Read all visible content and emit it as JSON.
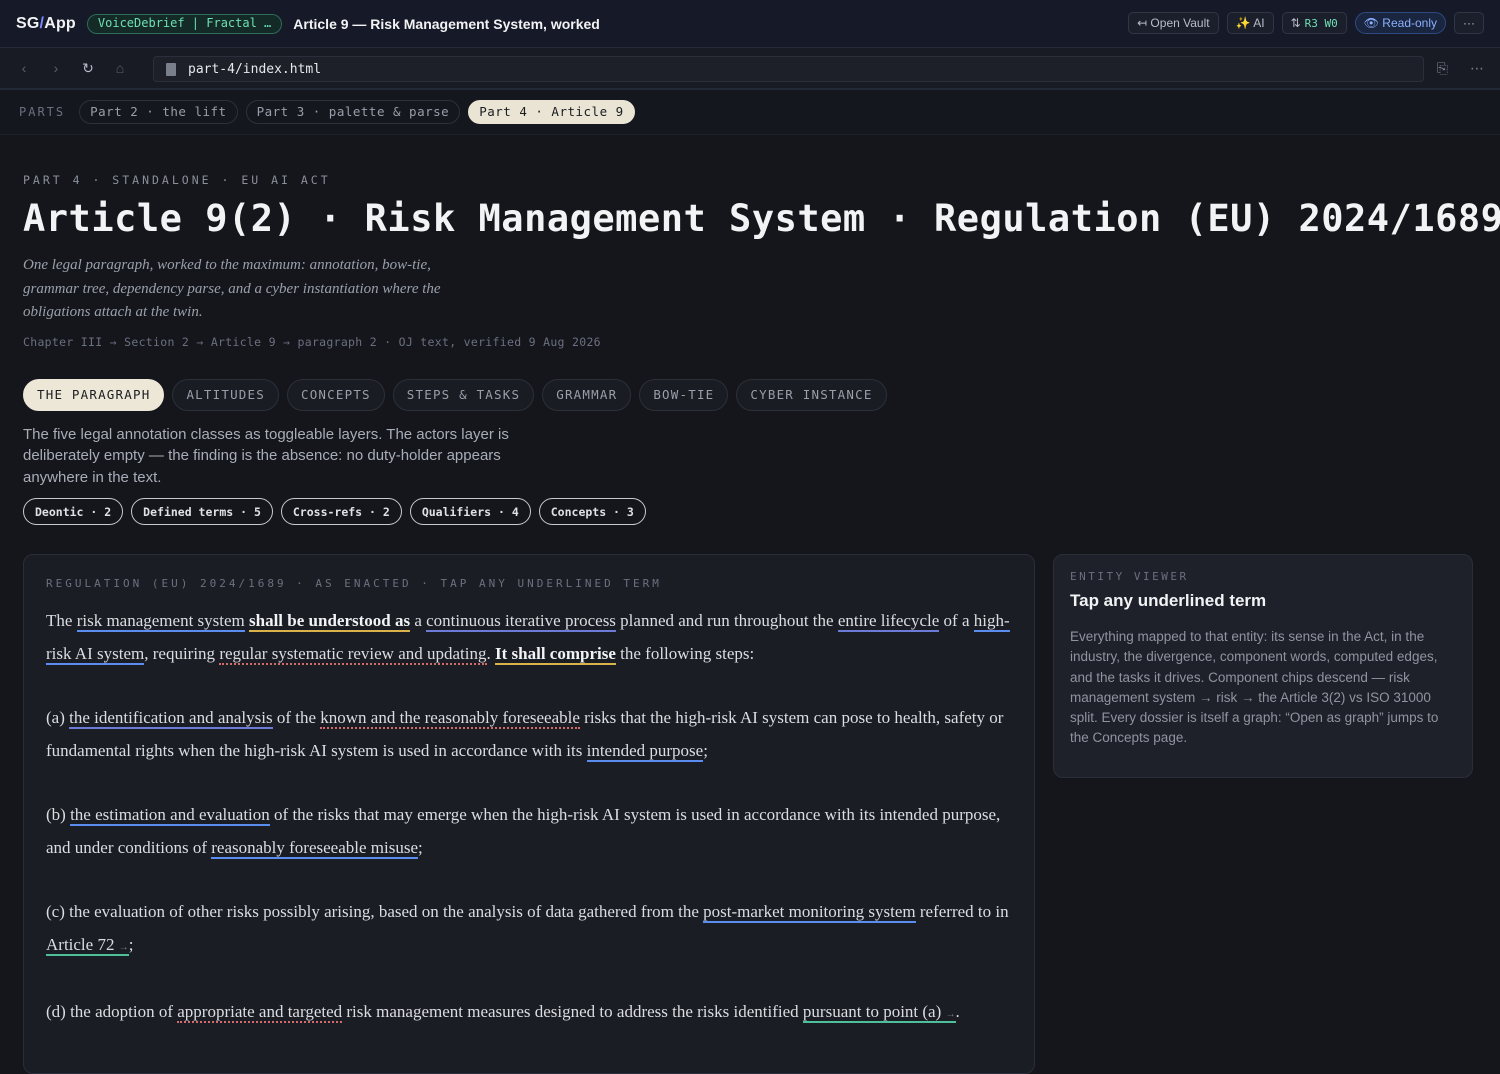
{
  "appbar": {
    "brand_a": "SG",
    "brand_sep": "/",
    "brand_b": "App",
    "project": "VoiceDebrief | Fractal …",
    "title": "Article 9 — Risk Management System, worked",
    "open_vault": "↤ Open Vault",
    "ai": "✨ AI",
    "sync_icon": "⇅",
    "sync": "R3 W0",
    "readonly": "👁 Read-only",
    "more": "···"
  },
  "navbar": {
    "back": "‹",
    "forward": "›",
    "reload": "↻",
    "home": "⌂",
    "url": "part-4/index.html",
    "copy": "⎘",
    "more": "⋯"
  },
  "parts": {
    "label": "PARTS",
    "tabs": [
      "Part 2 · the lift",
      "Part 3 · palette & parse",
      "Part 4 · Article 9"
    ]
  },
  "header": {
    "eyebrow": "PART 4 · STANDALONE · EU AI ACT",
    "title": "Article 9(2) · Risk Management System · Regulation (EU) 2024/1689",
    "lede": "One legal paragraph, worked to the maximum: annotation, bow-tie, grammar tree, dependency parse, and a cyber instantiation where the obligations attach at the twin.",
    "crumbs": "Chapter III → Section 2 → Article 9 → paragraph 2 · OJ text, verified 9 Aug 2026"
  },
  "tabs": [
    "THE PARAGRAPH",
    "ALTITUDES",
    "CONCEPTS",
    "STEPS & TASKS",
    "GRAMMAR",
    "BOW-TIE",
    "CYBER INSTANCE"
  ],
  "layers": {
    "description": "The five legal annotation classes as toggleable layers. The actors layer is deliberately empty — the finding is the absence: no duty-holder appears anywhere in the text.",
    "chips": [
      "Deontic · 2",
      "Defined terms · 5",
      "Cross-refs · 2",
      "Qualifiers · 4",
      "Concepts · 3"
    ]
  },
  "paragraph": {
    "eyebrow": "REGULATION (EU) 2024/1689 · AS ENACTED · TAP ANY UNDERLINED TERM",
    "p0": {
      "t0": "The ",
      "term_rms": "risk management system",
      "t1": " ",
      "deontic_1": "shall be understood as",
      "t2": " a ",
      "concept_1": "continuous iterative process",
      "t3": " planned and run throughout the ",
      "concept_2": "entire lifecycle",
      "t4": " of a ",
      "term_hrai": "high-risk AI system",
      "t5": ", requiring ",
      "qual_1": "regular systematic review and updating",
      "t6": ". ",
      "deontic_2": "It shall comprise",
      "t7": " the following steps:"
    },
    "pa": {
      "t0": "(a) ",
      "concept_3": "the identification and analysis",
      "t1": " of the ",
      "qual_2": "known and the reasonably foreseeable",
      "t2": " risks that the high-risk AI system can pose to health, safety or fundamental rights when the high-risk AI system is used in accordance with its ",
      "term_ip": "intended purpose",
      "t3": ";"
    },
    "pb": {
      "t0": "(b) ",
      "term_ee": "the estimation and evaluation",
      "t1": " of the risks that may emerge when the high-risk AI system is used in accordance with its intended purpose, and under conditions of ",
      "term_rfm": "reasonably foreseeable misuse",
      "t2": ";"
    },
    "pc": {
      "t0": "(c) the evaluation of other risks possibly arising, based on the analysis of data gathered from the ",
      "term_pmm": "post-market monitoring system",
      "t1": " referred to in ",
      "xref_1": "Article 72",
      "xref_1_mark": "→",
      "t2": ";"
    },
    "pd": {
      "t0": "(d) the adoption of ",
      "qual_3": "appropriate and targeted",
      "t1": " risk management measures designed to address the risks identified ",
      "xref_2": "pursuant to point (a)",
      "xref_2_mark": "→",
      "t2": "."
    }
  },
  "viewer": {
    "eyebrow": "ENTITY VIEWER",
    "title": "Tap any underlined term",
    "body": "Everything mapped to that entity: its sense in the Act, in the industry, the divergence, component words, computed edges, and the tasks it drives. Component chips descend — risk management system → risk → the Article 3(2) vs ISO 31000 split. Every dossier is itself a graph: “Open as graph” jumps to the Concepts page."
  },
  "colors": {
    "accent_blue": "#5b8cf0",
    "deontic_gold": "#d9b24a",
    "qualifier_red": "#d46a6a",
    "xref_green": "#4fbf9a",
    "active_tab": "#ece7d6"
  }
}
